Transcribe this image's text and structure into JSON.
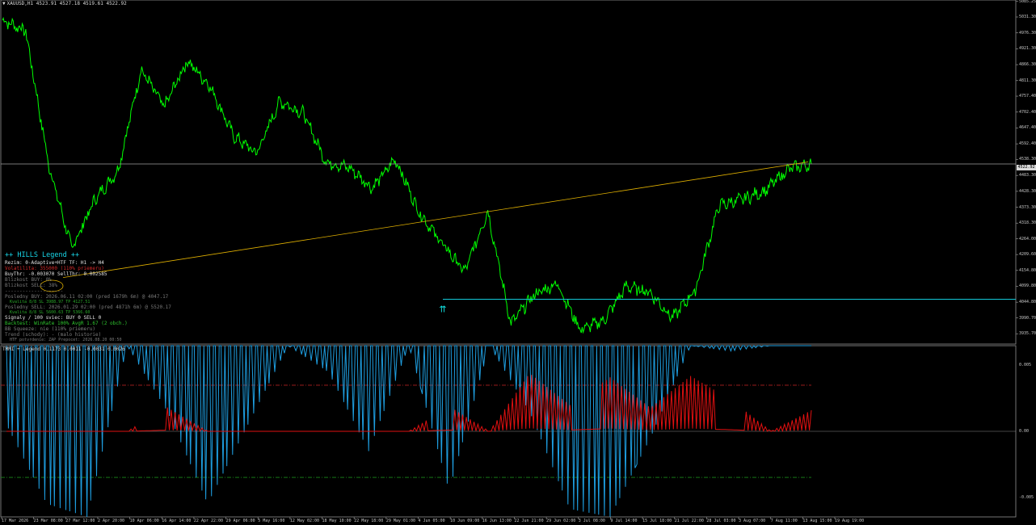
{
  "header": {
    "symbol": "XAUUSD,H1",
    "ohlc": "4523.91 4527.18 4519.61 4522.92"
  },
  "price_tag": "4522.92",
  "indicator_header": "TMMI + Legend 0.1173 0.0011 -0.0031 0.0026",
  "legend": {
    "title": "++ HILLS Legend ++",
    "lines": [
      {
        "text": "Rezim: 0-Adaptive+HTF   TF: H1 -> H4",
        "color": "white"
      },
      {
        "text": "Volatilita: 355000 (110% priemeru)",
        "color": "red"
      },
      {
        "text": "BuyThr: -0.003070   SellThr: 0.002585",
        "color": "white"
      },
      {
        "text": "Blizkost BUY: 0%",
        "color": "grey"
      },
      {
        "text": "Blizkost SELL: 38%",
        "color": "grey"
      },
      {
        "text": "--------------------",
        "color": "grey"
      },
      {
        "text": "Posledny BUY:  2026.06.11 02:00  (pred 1679h 6m)  @ 4047.17",
        "color": "grey"
      },
      {
        "text": "Kvalita 8/8   SL 3988.97   TP 4127.51",
        "color": "dgreen",
        "small": true
      },
      {
        "text": "Posledny SELL: 2026.01.29 02:00  (pred 4871h 6m)  @ 5520.17",
        "color": "grey"
      },
      {
        "text": "Kvalita 8/8   SL 5600.63   TP 5366.60",
        "color": "dgreen",
        "small": true
      },
      {
        "text": "Signaly / 100 sviec:  BUY 0   SELL 0",
        "color": "white"
      },
      {
        "text": "Backtest: WinRate 100%  AvgR 1.67  (2 obch.)",
        "color": "green"
      },
      {
        "text": "BB Squeeze: nie  (110% priemeru)",
        "color": "grey"
      },
      {
        "text": "Trend (schody): - (malo historie)",
        "color": "grey"
      },
      {
        "text": "HTF potvrdenie: ZAP   Prepocet: 2026.08.20 00:50",
        "color": "grey",
        "small": true
      }
    ]
  },
  "colors": {
    "background": "#000000",
    "price_line": "#00ff00",
    "trendline": "#e0b000",
    "support_line": "#12c8d8",
    "bid_line": "#a0a0a0",
    "osc_negative": "#1e9ee0",
    "osc_positive": "#e01010",
    "upper_level": "#b02020",
    "lower_level": "#1a8a1a",
    "buy_arrow": "#12e0e0"
  },
  "icons": {
    "buy_signal": "double-up-arrow-icon"
  },
  "chart_data": [
    {
      "type": "line",
      "series": [
        {
          "name": "XAUUSD,H1",
          "values": [
            5020,
            4985,
            4520,
            4230,
            4400,
            4500,
            4850,
            4720,
            4880,
            4790,
            4620,
            4560,
            4740,
            4700,
            4530,
            4510,
            4440,
            4540,
            4360,
            4250,
            4150,
            4360,
            3970,
            4070,
            4110,
            3950,
            3980,
            4100,
            4080,
            3990,
            4090,
            4380,
            4400,
            4430,
            4505,
            4522.92
          ]
        }
      ],
      "ylim": [
        3900,
        5090
      ],
      "yticks": [
        "5085.25",
        "5031.30",
        "4976.30",
        "4921.30",
        "4866.30",
        "4811.30",
        "4757.40",
        "4702.40",
        "4647.40",
        "4592.40",
        "4538.30",
        "4483.30",
        "4428.30",
        "4373.30",
        "4318.30",
        "4264.00",
        "4209.60",
        "4154.80",
        "4099.80",
        "4044.80",
        "3990.70",
        "3935.70"
      ],
      "current_price": 4522.92,
      "support_level": 4055,
      "trendline": {
        "from": 4130,
        "to": 4530
      }
    },
    {
      "type": "line",
      "series": [
        {
          "values": [
            -0.003,
            -0.006,
            -0.0065,
            0,
            -0.0025,
            -0.006,
            -0.003,
            0,
            -0.001,
            -0.004,
            0,
            -0.0055,
            0,
            -0.0025,
            -0.0062,
            -0.0065,
            -0.0035,
            0,
            -0.0002,
            0,
            0
          ]
        },
        {
          "values": [
            0,
            0,
            0,
            0,
            0.0018,
            0,
            0,
            0,
            0,
            0,
            0,
            0.0019,
            0,
            0.0044,
            0.002,
            0.0041,
            0.0018,
            0.0042,
            0.0024,
            0,
            0.0016
          ]
        }
      ],
      "ylim": [
        -0.0065,
        0.0065
      ],
      "yticks": [
        "0.005",
        "0.00",
        "-0.005"
      ],
      "levels": [
        0.0035,
        -0.0035
      ]
    }
  ],
  "x_axis": [
    "17 Mar 2026",
    "23 Mar 08:00",
    "27 Mar 12:00",
    "2 Apr 20:00",
    "10 Apr 06:00",
    "16 Apr 14:00",
    "22 Apr 22:00",
    "29 Apr 06:00",
    "5 May 16:00",
    "12 May 02:00",
    "18 May 10:00",
    "22 May 18:00",
    "29 May 01:00",
    "4 Jun 05:00",
    "10 Jun 09:00",
    "16 Jun 13:00",
    "22 Jun 21:00",
    "29 Jun 02:00",
    "3 Jul 08:00",
    "9 Jul 14:00",
    "15 Jul 18:00",
    "21 Jul 22:00",
    "28 Jul 03:00",
    "3 Aug 07:00",
    "7 Aug 11:00",
    "13 Aug 15:00",
    "19 Aug 19:00"
  ]
}
